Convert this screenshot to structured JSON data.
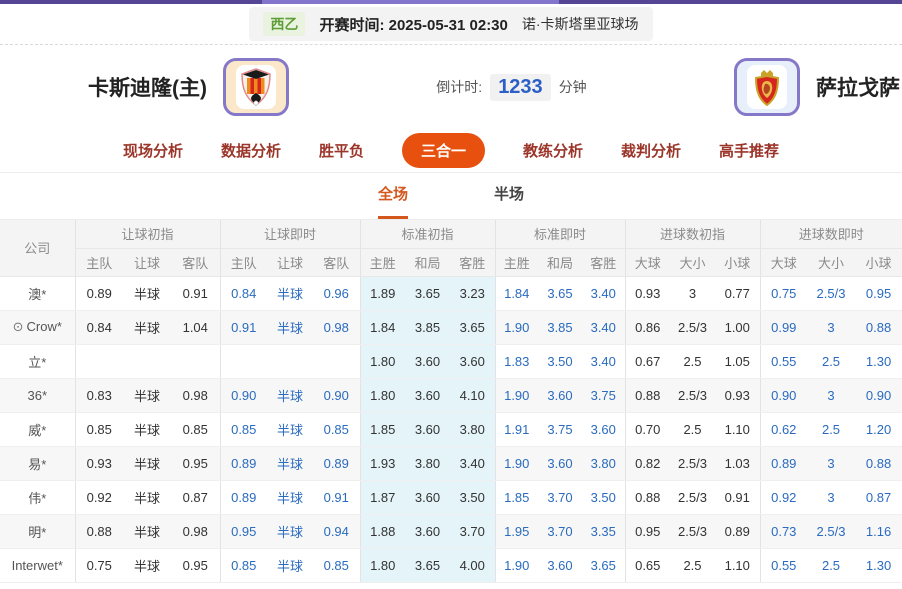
{
  "top_bar": {
    "league": "西乙",
    "kickoff_label": "开赛时间:",
    "kickoff_time": "2025-05-31 02:30",
    "venue": "诺·卡斯塔里亚球场"
  },
  "match": {
    "home_name": "卡斯迪隆(主)",
    "away_name": "萨拉戈萨",
    "countdown_label": "倒计时:",
    "countdown_value": "1233",
    "countdown_unit": "分钟"
  },
  "nav": {
    "tabs": [
      {
        "label": "现场分析",
        "active": false
      },
      {
        "label": "数据分析",
        "active": false
      },
      {
        "label": "胜平负",
        "active": false
      },
      {
        "label": "三合一",
        "active": true
      },
      {
        "label": "教练分析",
        "active": false
      },
      {
        "label": "裁判分析",
        "active": false
      },
      {
        "label": "高手推荐",
        "active": false
      }
    ]
  },
  "subtabs": [
    {
      "label": "全场",
      "active": true
    },
    {
      "label": "半场",
      "active": false
    }
  ],
  "odds_table": {
    "company_header": "公司",
    "groups": [
      {
        "label": "让球初指",
        "cols": [
          "主队",
          "让球",
          "客队"
        ]
      },
      {
        "label": "让球即时",
        "cols": [
          "主队",
          "让球",
          "客队"
        ]
      },
      {
        "label": "标准初指",
        "cols": [
          "主胜",
          "和局",
          "客胜"
        ]
      },
      {
        "label": "标准即时",
        "cols": [
          "主胜",
          "和局",
          "客胜"
        ]
      },
      {
        "label": "进球数初指",
        "cols": [
          "大球",
          "大小",
          "小球"
        ]
      },
      {
        "label": "进球数即时",
        "cols": [
          "大球",
          "大小",
          "小球"
        ]
      }
    ],
    "rows": [
      {
        "company": "澳*",
        "icon": false,
        "handicap_init": [
          "0.89",
          "半球",
          "0.91"
        ],
        "handicap_live": [
          "0.84",
          "半球",
          "0.96"
        ],
        "std_init": [
          "1.89",
          "3.65",
          "3.23"
        ],
        "std_live": [
          "1.84",
          "3.65",
          "3.40"
        ],
        "goals_init": [
          "0.93",
          "3",
          "0.77"
        ],
        "goals_live": [
          "0.75",
          "2.5/3",
          "0.95"
        ]
      },
      {
        "company": "Crow*",
        "icon": true,
        "handicap_init": [
          "0.84",
          "半球",
          "1.04"
        ],
        "handicap_live": [
          "0.91",
          "半球",
          "0.98"
        ],
        "std_init": [
          "1.84",
          "3.85",
          "3.65"
        ],
        "std_live": [
          "1.90",
          "3.85",
          "3.40"
        ],
        "goals_init": [
          "0.86",
          "2.5/3",
          "1.00"
        ],
        "goals_live": [
          "0.99",
          "3",
          "0.88"
        ]
      },
      {
        "company": "立*",
        "icon": false,
        "handicap_init": [
          "",
          "",
          ""
        ],
        "handicap_live": [
          "",
          "",
          ""
        ],
        "std_init": [
          "1.80",
          "3.60",
          "3.60"
        ],
        "std_live": [
          "1.83",
          "3.50",
          "3.40"
        ],
        "goals_init": [
          "0.67",
          "2.5",
          "1.05"
        ],
        "goals_live": [
          "0.55",
          "2.5",
          "1.30"
        ]
      },
      {
        "company": "36*",
        "icon": false,
        "handicap_init": [
          "0.83",
          "半球",
          "0.98"
        ],
        "handicap_live": [
          "0.90",
          "半球",
          "0.90"
        ],
        "std_init": [
          "1.80",
          "3.60",
          "4.10"
        ],
        "std_live": [
          "1.90",
          "3.60",
          "3.75"
        ],
        "goals_init": [
          "0.88",
          "2.5/3",
          "0.93"
        ],
        "goals_live": [
          "0.90",
          "3",
          "0.90"
        ]
      },
      {
        "company": "威*",
        "icon": false,
        "handicap_init": [
          "0.85",
          "半球",
          "0.85"
        ],
        "handicap_live": [
          "0.85",
          "半球",
          "0.85"
        ],
        "std_init": [
          "1.85",
          "3.60",
          "3.80"
        ],
        "std_live": [
          "1.91",
          "3.75",
          "3.60"
        ],
        "goals_init": [
          "0.70",
          "2.5",
          "1.10"
        ],
        "goals_live": [
          "0.62",
          "2.5",
          "1.20"
        ]
      },
      {
        "company": "易*",
        "icon": false,
        "handicap_init": [
          "0.93",
          "半球",
          "0.95"
        ],
        "handicap_live": [
          "0.89",
          "半球",
          "0.89"
        ],
        "std_init": [
          "1.93",
          "3.80",
          "3.40"
        ],
        "std_live": [
          "1.90",
          "3.60",
          "3.80"
        ],
        "goals_init": [
          "0.82",
          "2.5/3",
          "1.03"
        ],
        "goals_live": [
          "0.89",
          "3",
          "0.88"
        ]
      },
      {
        "company": "伟*",
        "icon": false,
        "handicap_init": [
          "0.92",
          "半球",
          "0.87"
        ],
        "handicap_live": [
          "0.89",
          "半球",
          "0.91"
        ],
        "std_init": [
          "1.87",
          "3.60",
          "3.50"
        ],
        "std_live": [
          "1.85",
          "3.70",
          "3.50"
        ],
        "goals_init": [
          "0.88",
          "2.5/3",
          "0.91"
        ],
        "goals_live": [
          "0.92",
          "3",
          "0.87"
        ]
      },
      {
        "company": "明*",
        "icon": false,
        "handicap_init": [
          "0.88",
          "半球",
          "0.98"
        ],
        "handicap_live": [
          "0.95",
          "半球",
          "0.94"
        ],
        "std_init": [
          "1.88",
          "3.60",
          "3.70"
        ],
        "std_live": [
          "1.95",
          "3.70",
          "3.35"
        ],
        "goals_init": [
          "0.95",
          "2.5/3",
          "0.89"
        ],
        "goals_live": [
          "0.73",
          "2.5/3",
          "1.16"
        ]
      },
      {
        "company": "Interwet*",
        "icon": false,
        "handicap_init": [
          "0.75",
          "半球",
          "0.95"
        ],
        "handicap_live": [
          "0.85",
          "半球",
          "0.85"
        ],
        "std_init": [
          "1.80",
          "3.65",
          "4.00"
        ],
        "std_live": [
          "1.90",
          "3.60",
          "3.65"
        ],
        "goals_init": [
          "0.65",
          "2.5",
          "1.10"
        ],
        "goals_live": [
          "0.55",
          "2.5",
          "1.30"
        ]
      }
    ]
  },
  "colors": {
    "accent_orange": "#e8500f",
    "subtab_orange": "#d4571e",
    "live_blue": "#2a6bbf",
    "countdown_blue": "#2b5fc7",
    "std_init_bg": "#e4f4f9",
    "top_purple": "#544694",
    "league_green": "#5f9e37"
  }
}
